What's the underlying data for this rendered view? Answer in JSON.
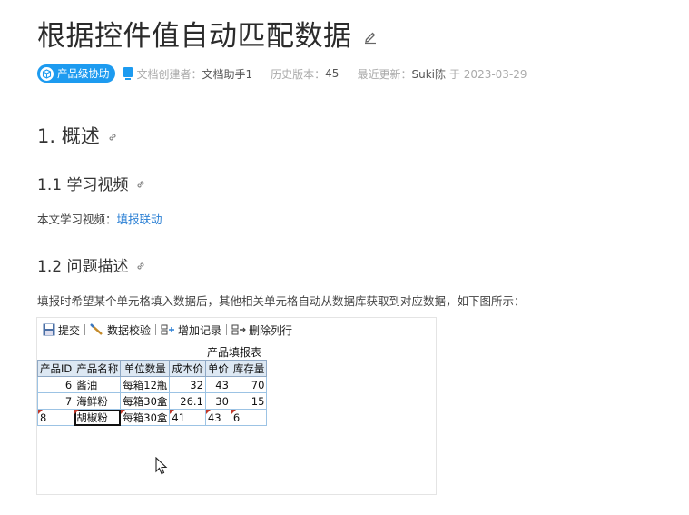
{
  "page": {
    "title": "根据控件值自动匹配数据"
  },
  "meta": {
    "badge": "产品级协助",
    "creator_label": "文档创建者：",
    "creator": "文档助手1",
    "version_label": "历史版本：",
    "version": "45",
    "updated_label": "最近更新：",
    "updated_by": "Suki陈",
    "updated_on": "于 2023-03-29"
  },
  "sections": {
    "s1": "1. 概述",
    "s11": "1.1 学习视频",
    "s11_text": "本文学习视频：",
    "s11_link": "填报联动",
    "s12": "1.2 问题描述",
    "s12_text": "填报时希望某个单元格填入数据后，其他相关单元格自动从数据库获取到对应数据，如下图所示："
  },
  "app": {
    "toolbar": {
      "submit": "提交",
      "validate": "数据校验",
      "add_record": "增加记录",
      "delete_row": "删除列行"
    },
    "report_title": "产品填报表",
    "columns": [
      "产品ID",
      "产品名称",
      "单位数量",
      "成本价",
      "单价",
      "库存量"
    ],
    "rows": [
      [
        "6",
        "酱油",
        "每箱12瓶",
        "32",
        "43",
        "70"
      ],
      [
        "7",
        "海鲜粉",
        "每箱30盒",
        "26.1",
        "30",
        "15"
      ],
      [
        "8",
        "胡椒粉",
        "每箱30盒",
        "41",
        "43",
        "6"
      ]
    ]
  },
  "colors": {
    "accent": "#1d9bf0",
    "link": "#2a7fd4"
  }
}
